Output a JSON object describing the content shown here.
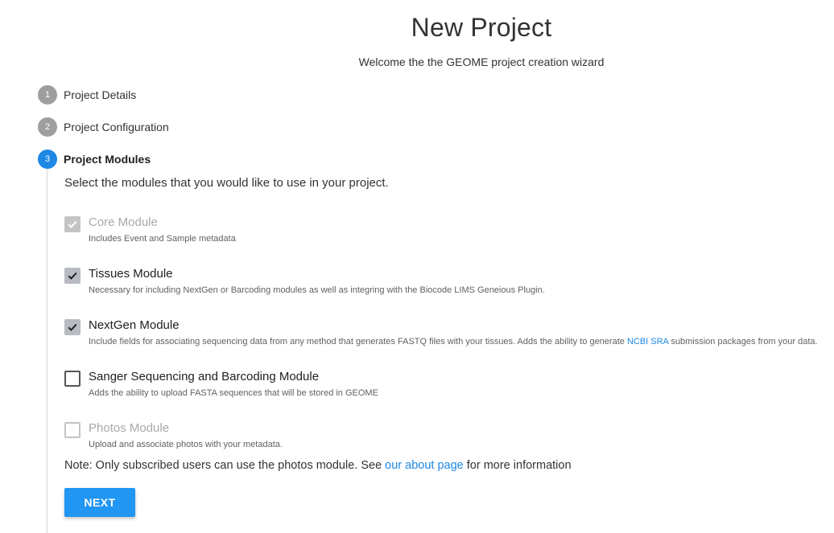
{
  "header": {
    "title": "New Project",
    "subtitle": "Welcome the the GEOME project creation wizard"
  },
  "steps": [
    {
      "number": "1",
      "label": "Project Details",
      "active": false
    },
    {
      "number": "2",
      "label": "Project Configuration",
      "active": false
    },
    {
      "number": "3",
      "label": "Project Modules",
      "active": true
    }
  ],
  "modules_step": {
    "intro": "Select the modules that you would like to use in your project.",
    "modules": [
      {
        "label": "Core Module",
        "description": "Includes Event and Sample metadata",
        "checked": true,
        "disabled": true
      },
      {
        "label": "Tissues Module",
        "description": "Necessary for including NextGen or Barcoding modules as well as integring with the Biocode LIMS Geneious Plugin.",
        "checked": true,
        "disabled": false
      },
      {
        "label": "NextGen Module",
        "description_before": "Include fields for associating sequencing data from any method that generates FASTQ files with your tissues. Adds the ability to generate ",
        "description_link": "NCBI SRA",
        "description_after": " submission packages from your data.",
        "checked": true,
        "disabled": false
      },
      {
        "label": "Sanger Sequencing and Barcoding Module",
        "description": "Adds the ability to upload FASTA sequences that will be stored in GEOME",
        "checked": false,
        "disabled": false
      },
      {
        "label": "Photos Module",
        "description": "Upload and associate photos with your metadata.",
        "checked": false,
        "disabled": true
      }
    ],
    "note_before": "Note: Only subscribed users can use the photos module. See ",
    "note_link": "our about page",
    "note_after": " for more information",
    "next_label": "NEXT"
  },
  "colors": {
    "accent": "#1e88e5",
    "button": "#2196f3",
    "step_inactive": "#9e9e9e"
  },
  "icons": {
    "checkbox_checked": "check-icon"
  }
}
